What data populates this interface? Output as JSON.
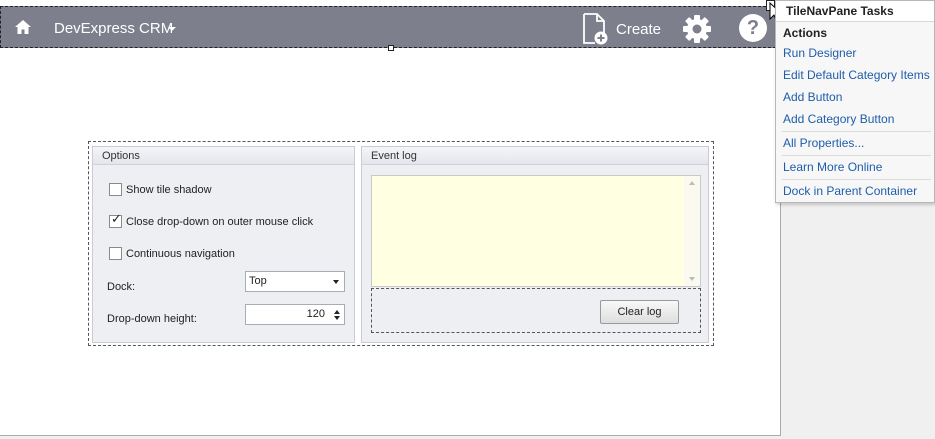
{
  "tile_nav_pane": {
    "title": "DevExpress CRM",
    "create_label": "Create",
    "help_label": "?"
  },
  "options_group": {
    "header": "Options",
    "show_tile_shadow": {
      "label": "Show tile shadow",
      "checked": false
    },
    "close_dropdown": {
      "label": "Close drop-down on outer mouse click",
      "checked": true
    },
    "continuous_navigation": {
      "label": "Continuous navigation",
      "checked": false
    },
    "dock_label": "Dock:",
    "dock_value": "Top",
    "height_label": "Drop-down height:",
    "height_value": "120"
  },
  "event_log_group": {
    "header": "Event log",
    "log_text": "",
    "clear_button": "Clear log"
  },
  "tasks_panel": {
    "title": "TileNavPane Tasks",
    "section": "Actions",
    "items": [
      "Run Designer",
      "Edit Default Category Items",
      "Add Button",
      "Add Category Button",
      "All Properties...",
      "Learn More Online",
      "Dock in Parent Container"
    ]
  },
  "colors": {
    "nav_background": "#7d7f8c",
    "log_background": "#ffffe1",
    "link": "#1f5dab"
  }
}
